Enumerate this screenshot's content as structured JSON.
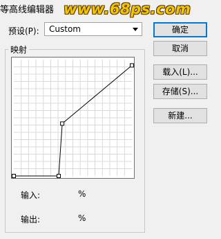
{
  "window": {
    "title": "等高线编辑器",
    "watermark": "www.68ps.com"
  },
  "preset": {
    "label": "预设(P):",
    "value": "Custom"
  },
  "buttons": {
    "ok": "确定",
    "cancel": "取消",
    "load": "载入(L)...",
    "save": "存储(S)...",
    "new": "新建..."
  },
  "mapping": {
    "label": "映射",
    "curve_points": [
      {
        "input": 0,
        "output": 0
      },
      {
        "input": 38,
        "output": 0
      },
      {
        "input": 41,
        "output": 45
      },
      {
        "input": 100,
        "output": 95
      }
    ]
  },
  "io": {
    "input_label": "输入:",
    "input_value": "%",
    "output_label": "输出:",
    "output_value": "%"
  }
}
